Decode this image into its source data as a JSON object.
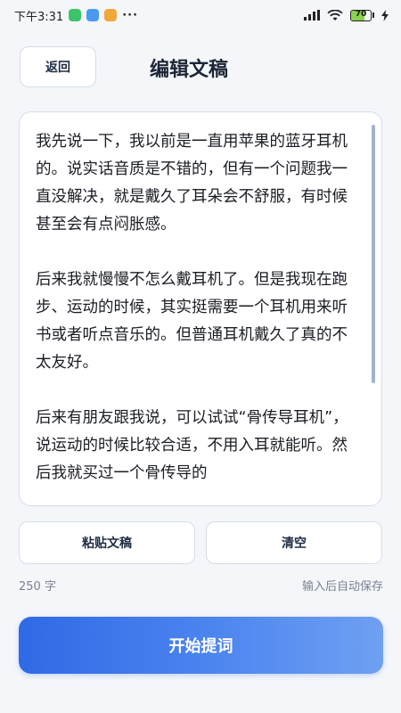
{
  "status_bar": {
    "time": "下午3:31",
    "more": "···",
    "battery": "70",
    "app_colors": [
      "#3cc46a",
      "#4a9bf0",
      "#f2a73a"
    ]
  },
  "header": {
    "back_label": "返回",
    "title": "编辑文稿"
  },
  "editor": {
    "text": "我先说一下，我以前是一直用苹果的蓝牙耳机的。说实话音质是不错的，但有一个问题我一直没解决，就是戴久了耳朵会不舒服，有时候甚至会有点闷胀感。\n\n后来我就慢慢不怎么戴耳机了。但是我现在跑步、运动的时候，其实挺需要一个耳机用来听书或者听点音乐的。但普通耳机戴久了真的不太友好。\n\n后来有朋友跟我说，可以试试“骨传导耳机”，说运动的时候比较合适，不用入耳就能听。然后我就买过一个骨传导的"
  },
  "actions": {
    "paste_label": "粘贴文稿",
    "clear_label": "清空"
  },
  "footer": {
    "char_count": "250 字",
    "autosave": "输入后自动保存",
    "start_label": "开始提词"
  },
  "colors": {
    "accent": "#2f6ae6",
    "border": "#d6dde8",
    "background": "#f4f6fa"
  }
}
